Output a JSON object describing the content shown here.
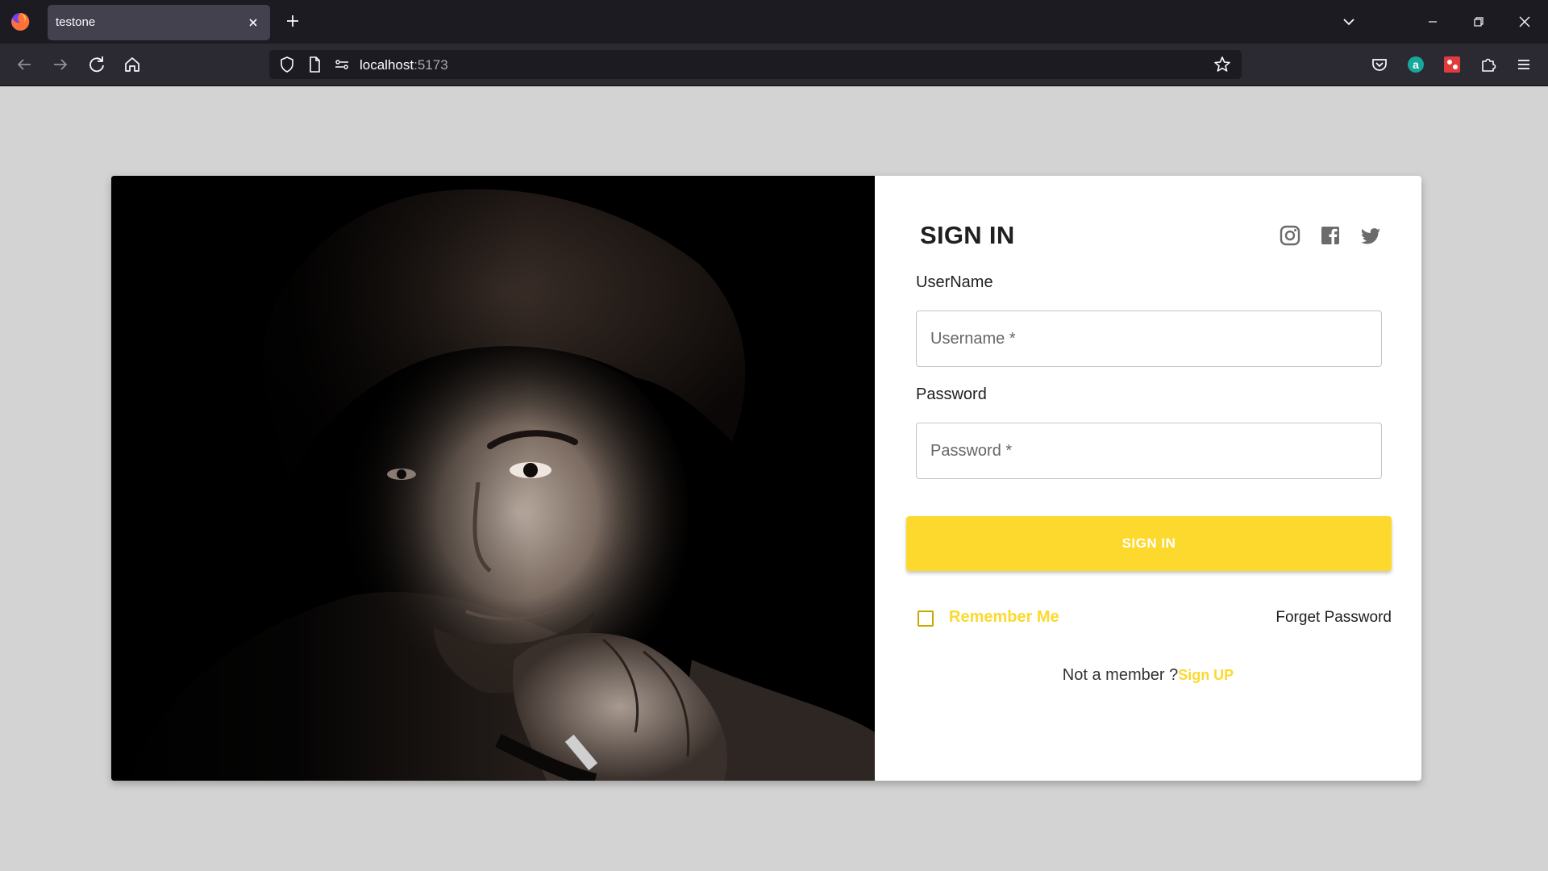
{
  "browser": {
    "tab_title": "testone",
    "url_host": "localhost",
    "url_port": ":5173"
  },
  "form": {
    "title": "SIGN IN",
    "username_label": "UserName",
    "username_placeholder": "Username *",
    "password_label": "Password",
    "password_placeholder": "Password *",
    "submit_label": "SIGN IN",
    "remember_label": "Remember Me",
    "forget_label": "Forget Password",
    "not_member_text": "Not a member ?",
    "signup_label": "Sign UP"
  },
  "social_icons": [
    "instagram-icon",
    "facebook-icon",
    "twitter-icon"
  ],
  "colors": {
    "accent": "#fdd92e",
    "page_bg": "#d3d3d3",
    "tab_bar": "#1c1b22",
    "nav_bar": "#2b2a33"
  }
}
